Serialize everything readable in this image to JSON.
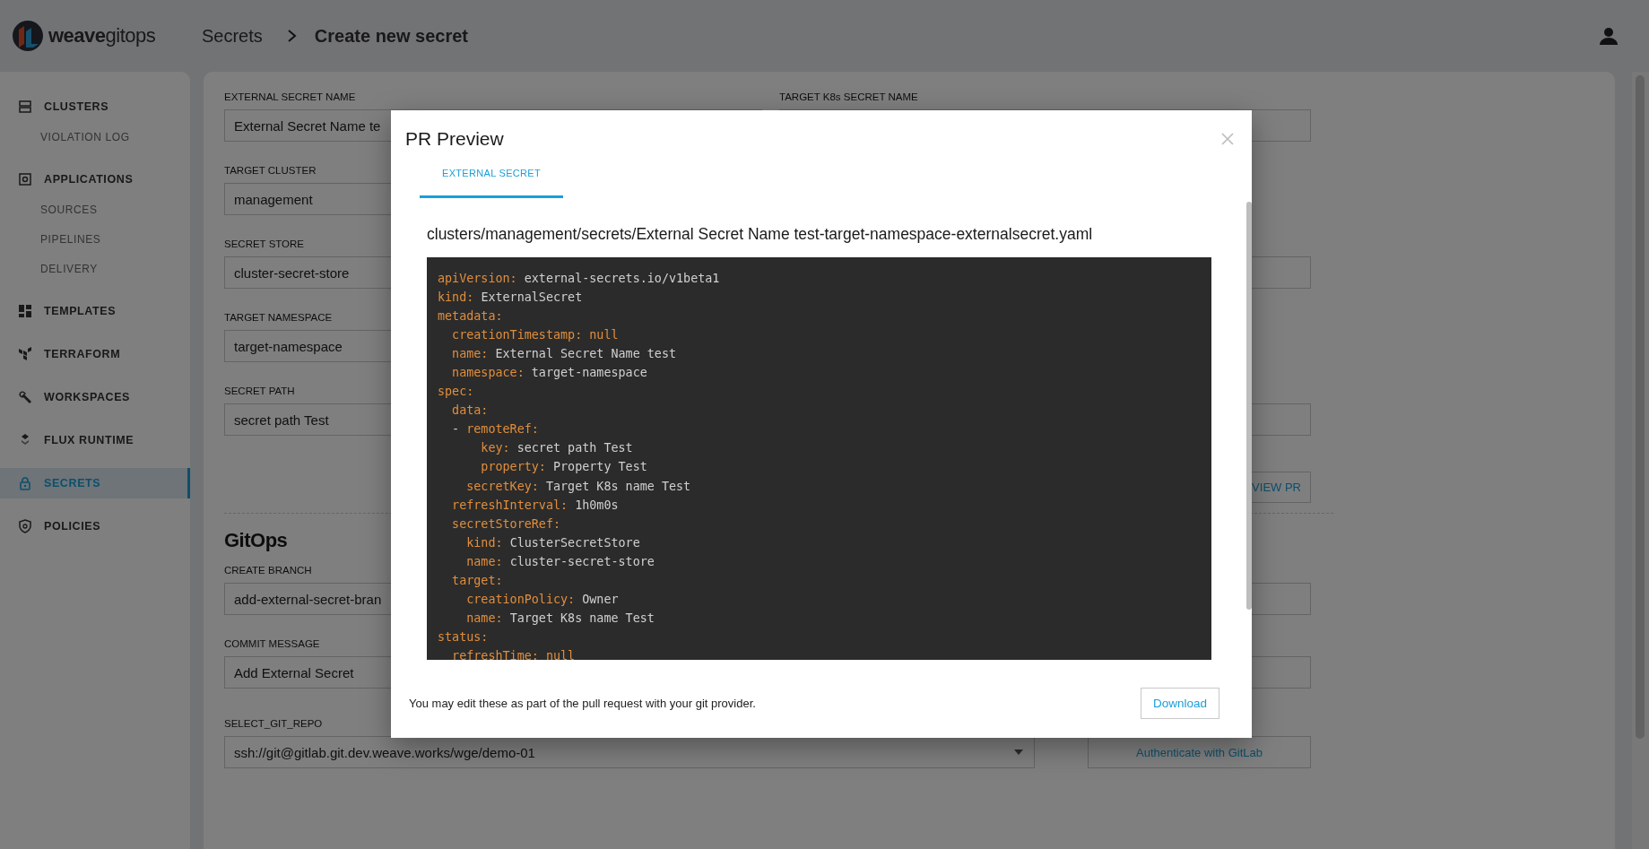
{
  "header": {
    "logo": "**weave**gitops",
    "breadcrumbs": [
      {
        "label": "Secrets"
      },
      {
        "label": "Create new secret"
      }
    ]
  },
  "sidebar": {
    "items": [
      {
        "label": "CLUSTERS",
        "kind": "main",
        "selected": false
      },
      {
        "label": "VIOLATION LOG",
        "kind": "sub",
        "selected": false
      },
      {
        "label": "APPLICATIONS",
        "kind": "main",
        "selected": false
      },
      {
        "label": "SOURCES",
        "kind": "sub",
        "selected": false
      },
      {
        "label": "PIPELINES",
        "kind": "sub",
        "selected": false
      },
      {
        "label": "DELIVERY",
        "kind": "sub",
        "selected": false
      },
      {
        "label": "TEMPLATES",
        "kind": "main",
        "selected": false
      },
      {
        "label": "TERRAFORM",
        "kind": "main",
        "selected": false
      },
      {
        "label": "WORKSPACES",
        "kind": "main",
        "selected": false
      },
      {
        "label": "FLUX RUNTIME",
        "kind": "main",
        "selected": false
      },
      {
        "label": "SECRETS",
        "kind": "main",
        "selected": true
      },
      {
        "label": "POLICIES",
        "kind": "main",
        "selected": false
      }
    ]
  },
  "form": {
    "left_fields": [
      {
        "label": "EXTERNAL SECRET NAME",
        "value": "External Secret Name te"
      },
      {
        "label": "TARGET CLUSTER",
        "value": "management"
      },
      {
        "label": "SECRET STORE",
        "value": "cluster-secret-store"
      },
      {
        "label": "TARGET NAMESPACE",
        "value": "target-namespace"
      },
      {
        "label": "SECRET PATH",
        "value": "secret path Test"
      }
    ],
    "right_fields": [
      {
        "kind": "input",
        "label": "TARGET K8s SECRET NAME"
      },
      {
        "kind": "blank"
      },
      {
        "kind": "input"
      },
      {
        "kind": "blank"
      },
      {
        "kind": "input"
      }
    ],
    "preview_button": "VIEW PR"
  },
  "gitops": {
    "title": "GitOps",
    "left_fields": [
      {
        "label": "CREATE BRANCH",
        "value": "add-external-secret-bran"
      },
      {
        "label": "COMMIT MESSAGE",
        "value": "Add External Secret"
      }
    ],
    "right_fields": [
      {
        "kind": "input"
      },
      {
        "kind": "input"
      }
    ],
    "repo": {
      "label": "SELECT_GIT_REPO",
      "value": "ssh://git@gitlab.git.dev.weave.works/wge/demo-01"
    },
    "auth_button": "Authenticate with GitLab"
  },
  "dialog": {
    "title": "PR Preview",
    "tabs": [
      {
        "label": "EXTERNAL SECRET",
        "selected": true
      }
    ],
    "file_path": "clusters/management/secrets/External Secret Name test-target-namespace-externalsecret.yaml",
    "code": [
      {
        "key": "apiVersion:",
        "value": "external-secrets.io/v1beta1",
        "literal": false
      },
      {
        "key": "kind:",
        "value": "ExternalSecret",
        "literal": false
      },
      {
        "key": "metadata:"
      },
      {
        "key": "  creationTimestamp:",
        "value": "null",
        "literal": true
      },
      {
        "key": "  name:",
        "value": "External Secret Name test",
        "literal": false
      },
      {
        "key": "  namespace:",
        "value": "target-namespace",
        "literal": false
      },
      {
        "key": "spec:"
      },
      {
        "key": "  data:"
      },
      {
        "lead": "  - ",
        "key": "remoteRef:"
      },
      {
        "key": "      key:",
        "value": "secret path Test",
        "literal": false
      },
      {
        "key": "      property:",
        "value": "Property Test",
        "literal": false
      },
      {
        "key": "    secretKey:",
        "value": "Target K8s name Test",
        "literal": false
      },
      {
        "key": "  refreshInterval:",
        "value": "1h0m0s",
        "literal": false
      },
      {
        "key": "  secretStoreRef:"
      },
      {
        "key": "    kind:",
        "value": "ClusterSecretStore",
        "literal": false
      },
      {
        "key": "    name:",
        "value": "cluster-secret-store",
        "literal": false
      },
      {
        "key": "  target:"
      },
      {
        "key": "    creationPolicy:",
        "value": "Owner",
        "literal": false
      },
      {
        "key": "    name:",
        "value": "Target K8s name Test",
        "literal": false
      },
      {
        "key": "status:"
      },
      {
        "key": "  refreshTime:",
        "value": "null",
        "literal": true
      }
    ],
    "footer_note": "You may edit these as part of the pull request with your git provider.",
    "download_button": "Download"
  }
}
